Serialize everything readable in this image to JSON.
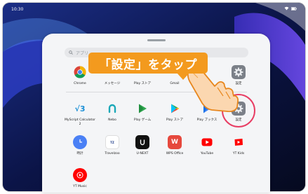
{
  "status": {
    "time": "10:30"
  },
  "search": {
    "placeholder": "アプリ"
  },
  "callout": {
    "text": "「設定」をタップ"
  },
  "recent_apps": [
    {
      "label": "Chrome",
      "icon": "chrome-icon"
    },
    {
      "label": "メッセージ",
      "icon": "messages-icon"
    },
    {
      "label": "Play ストア",
      "icon": "play-store-icon"
    },
    {
      "label": "Gmail",
      "icon": "gmail-icon"
    },
    {
      "label": "",
      "icon": "blank-icon"
    },
    {
      "label": "設定",
      "icon": "settings-icon"
    }
  ],
  "apps": [
    {
      "label": "MyScript Calculator 2",
      "icon": "myscript-calculator-icon"
    },
    {
      "label": "Nebo",
      "icon": "nebo-icon"
    },
    {
      "label": "Play ゲーム",
      "icon": "play-games-icon"
    },
    {
      "label": "Play ストア",
      "icon": "play-store-icon"
    },
    {
      "label": "Play ブックス",
      "icon": "play-books-icon"
    },
    {
      "label": "設定",
      "icon": "settings-icon"
    },
    {
      "label": "時計",
      "icon": "clock-icon"
    },
    {
      "label": "Travelzoo",
      "icon": "travelzoo-icon"
    },
    {
      "label": "U-NEXT",
      "icon": "unext-icon"
    },
    {
      "label": "WPS Office",
      "icon": "wps-office-icon"
    },
    {
      "label": "YouTube",
      "icon": "youtube-icon"
    },
    {
      "label": "YT Kids",
      "icon": "yt-kids-icon"
    },
    {
      "label": "YT Music",
      "icon": "yt-music-icon"
    }
  ],
  "colors": {
    "callout": "#f39a1e",
    "ring": "#e83e64",
    "accent": "#1a73e8"
  }
}
